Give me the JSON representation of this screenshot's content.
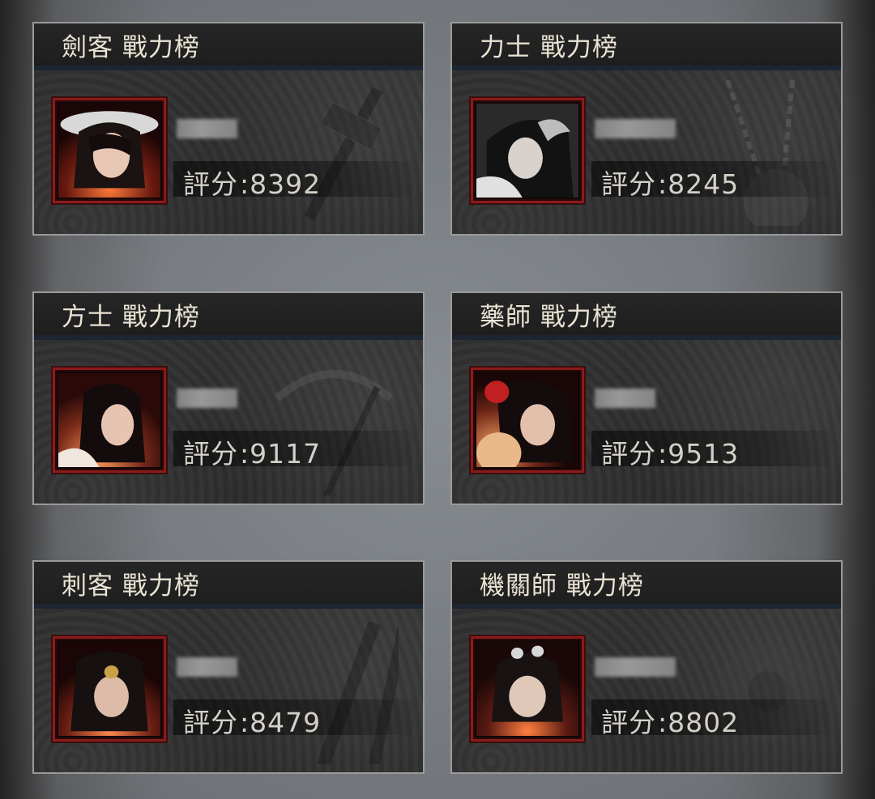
{
  "colors": {
    "title_text": "#e9e3d3",
    "score_text": "#d4d0c8",
    "frame_red": "#8a1b1b",
    "card_bg": "#2e2e2e"
  },
  "cards": [
    {
      "title": "劍客 戰力榜",
      "score_label": "評分",
      "score_value": ":8392",
      "portrait_icon": "swordsman-portrait-icon",
      "weapon_icon": "sword-icon"
    },
    {
      "title": "力士 戰力榜",
      "score_label": "評分",
      "score_value": ":8245",
      "portrait_icon": "warrior-portrait-icon",
      "weapon_icon": "mace-icon"
    },
    {
      "title": "方士 戰力榜",
      "score_label": "評分",
      "score_value": ":9117",
      "portrait_icon": "mage-portrait-icon",
      "weapon_icon": "staff-icon"
    },
    {
      "title": "藥師 戰力榜",
      "score_label": "評分",
      "score_value": ":9513",
      "portrait_icon": "healer-portrait-icon",
      "weapon_icon": "gourd-icon"
    },
    {
      "title": "刺客 戰力榜",
      "score_label": "評分",
      "score_value": ":8479",
      "portrait_icon": "assassin-portrait-icon",
      "weapon_icon": "dagger-icon"
    },
    {
      "title": "機關師 戰力榜",
      "score_label": "評分",
      "score_value": ":8802",
      "portrait_icon": "engineer-portrait-icon",
      "weapon_icon": "gear-icon"
    }
  ]
}
